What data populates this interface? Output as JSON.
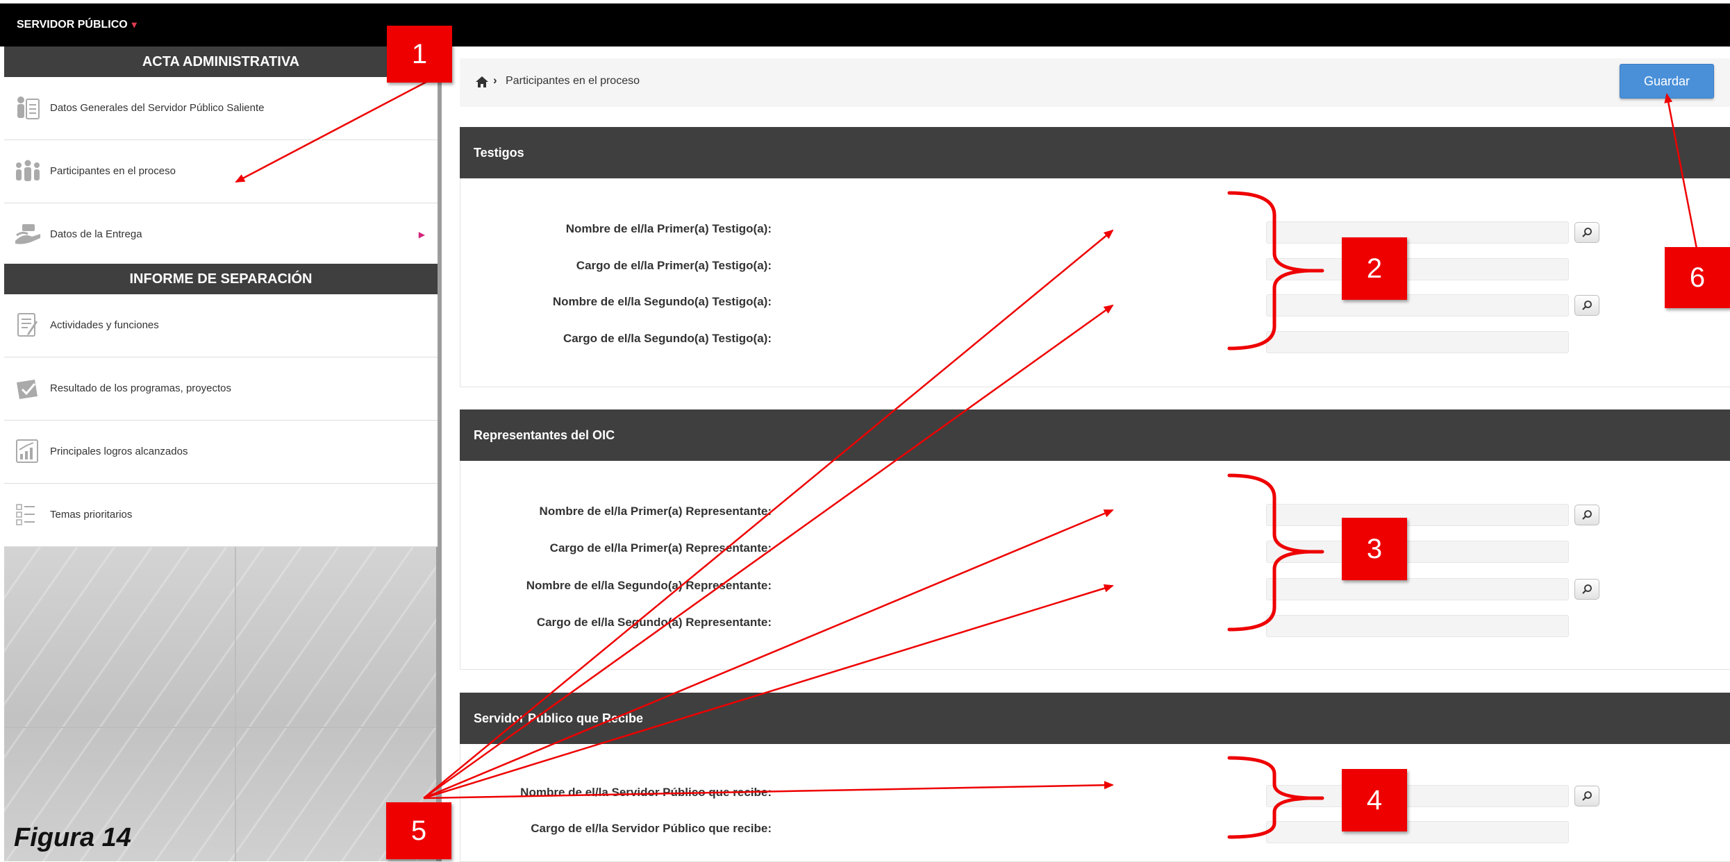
{
  "topbar": {
    "user": "SERVIDOR PÚBLICO"
  },
  "sidebar": {
    "section1": "ACTA ADMINISTRATIVA",
    "section2": "INFORME DE SEPARACIÓN",
    "items": [
      {
        "label": "Datos Generales del Servidor Público Saliente",
        "icon": "id-card-icon"
      },
      {
        "label": "Participantes en el proceso",
        "icon": "people-icon"
      },
      {
        "label": "Datos de la Entrega",
        "icon": "handover-icon"
      },
      {
        "label": "Actividades y funciones",
        "icon": "document-edit-icon"
      },
      {
        "label": "Resultado de los programas, proyectos",
        "icon": "check-book-icon"
      },
      {
        "label": "Principales logros alcanzados",
        "icon": "chart-up-icon"
      },
      {
        "label": "Temas prioritarios",
        "icon": "checklist-icon"
      }
    ]
  },
  "breadcrumb": {
    "current": "Participantes en el proceso"
  },
  "actions": {
    "save": "Guardar"
  },
  "panels": [
    {
      "title": "Testigos",
      "fields": [
        {
          "label": "Nombre de el/la Primer(a) Testigo(a):",
          "value": "",
          "search": true
        },
        {
          "label": "Cargo de el/la Primer(a) Testigo(a):",
          "value": "",
          "search": false
        },
        {
          "label": "Nombre de el/la Segundo(a) Testigo(a):",
          "value": "",
          "search": true
        },
        {
          "label": "Cargo de el/la Segundo(a) Testigo(a):",
          "value": "",
          "search": false
        }
      ]
    },
    {
      "title": "Representantes del OIC",
      "fields": [
        {
          "label": "Nombre de el/la Primer(a) Representante:",
          "value": "",
          "search": true
        },
        {
          "label": "Cargo de el/la Primer(a) Representante:",
          "value": "",
          "search": false
        },
        {
          "label": "Nombre de el/la Segundo(a) Representante:",
          "value": "",
          "search": true
        },
        {
          "label": "Cargo de el/la Segundo(a) Representante:",
          "value": "",
          "search": false
        }
      ]
    },
    {
      "title": "Servidor Público que Recibe",
      "fields": [
        {
          "label": "Nombre de el/la Servidor Público que recibe:",
          "value": "",
          "search": true
        },
        {
          "label": "Cargo de el/la Servidor Público que recibe:",
          "value": "",
          "search": false
        }
      ]
    }
  ],
  "annotations": {
    "badges": [
      "1",
      "2",
      "3",
      "4",
      "5",
      "6"
    ],
    "caption": "Figura 14",
    "color": "#ee0000"
  }
}
